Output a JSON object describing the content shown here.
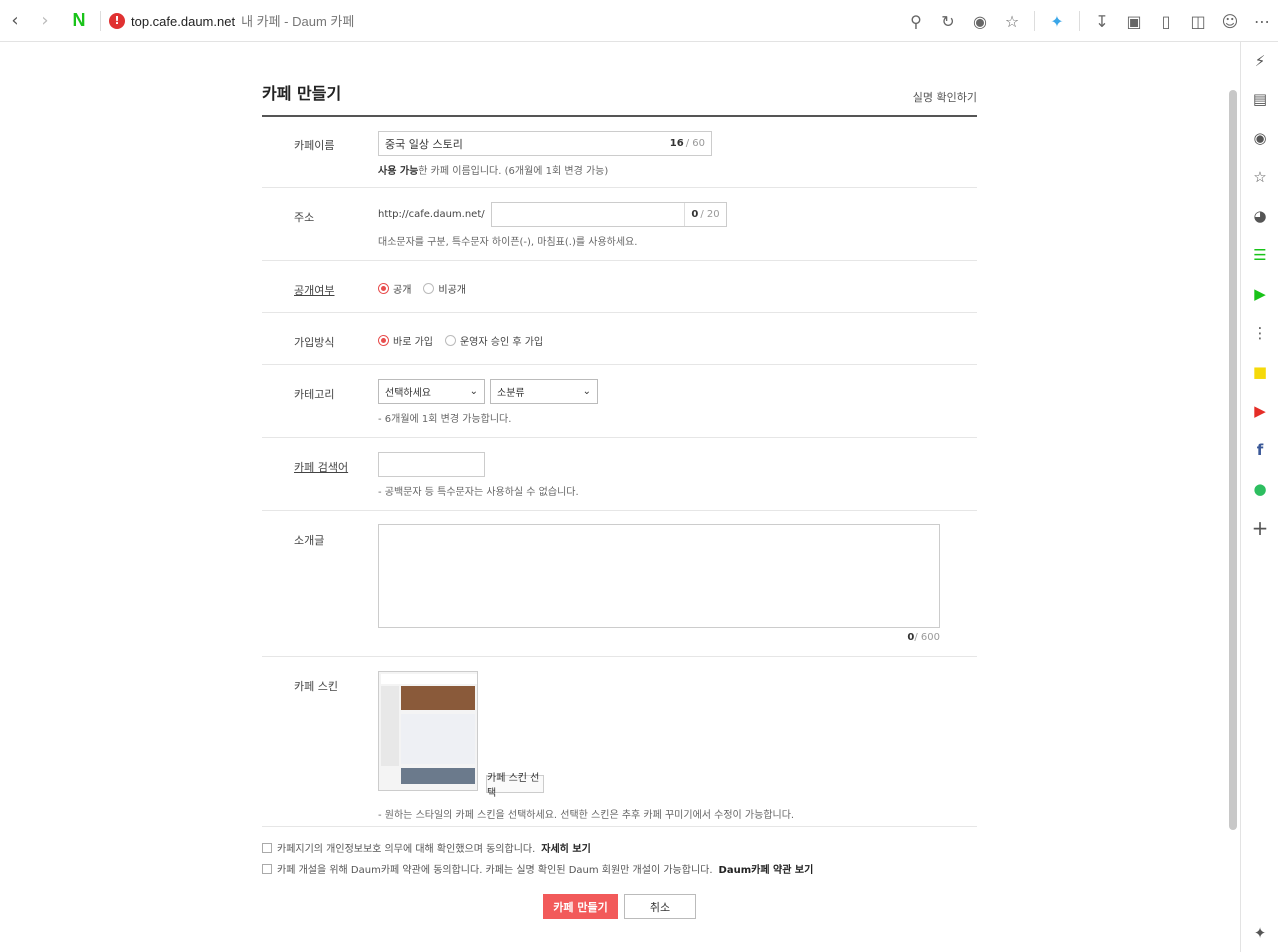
{
  "browser": {
    "url": "top.cafe.daum.net",
    "tab_title": "내 카페 - Daum 카페"
  },
  "page": {
    "title": "카페 만들기",
    "guide_link": "실명 확인하기"
  },
  "form": {
    "name": {
      "label": "카페이름",
      "value": "중국 일상 스토리",
      "count": "16",
      "max": "/ 60",
      "help_bold": "사용 가능",
      "help_rest": "한 카페 이름입니다. (6개월에 1회 변경 가능)"
    },
    "address": {
      "label": "주소",
      "prefix": "http://cafe.daum.net/",
      "value": "",
      "count": "0",
      "max": "/ 20",
      "help": "대소문자를 구분, 특수문자 하이픈(-), 마침표(.)를 사용하세요."
    },
    "visibility": {
      "label": "공개여부",
      "options": [
        "공개",
        "비공개"
      ]
    },
    "join": {
      "label": "가입방식",
      "options": [
        "바로 가입",
        "운영자 승인 후 가입"
      ]
    },
    "category": {
      "label": "카테고리",
      "main": "선택하세요",
      "sub": "소분류",
      "help": "- 6개월에 1회 변경 가능합니다."
    },
    "keyword": {
      "label": "카페 검색어",
      "help": "- 공백문자 등 특수문자는 사용하실 수 없습니다."
    },
    "intro": {
      "label": "소개글",
      "count": "0",
      "max": "/ 600"
    },
    "skin": {
      "label": "카페 스킨",
      "button": "카페 스킨 선택",
      "help": "- 원하는 스타일의 카페 스킨을 선택하세요. 선택한 스킨은 추후 카페 꾸미기에서 수정이 가능합니다."
    }
  },
  "agreements": [
    {
      "text": "카페지기의 개인정보보호 의무에 대해 확인했으며 동의합니다.",
      "link": "자세히 보기"
    },
    {
      "text": "카페 개설을 위해 Daum카페 약관에 동의합니다. 카페는 실명 확인된 Daum 회원만 개설이 가능합니다.",
      "link": "Daum카페 약관 보기"
    }
  ],
  "buttons": {
    "create": "카페 만들기",
    "cancel": "취소"
  },
  "colors": {
    "accent": "#f25a5a",
    "naver_green": "#19c319"
  }
}
